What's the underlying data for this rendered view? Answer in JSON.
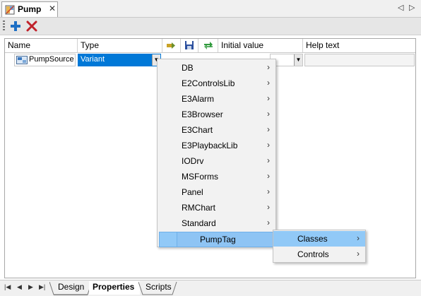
{
  "window": {
    "tab_title": "Pump",
    "close_glyph": "✕",
    "nav_prev": "◁",
    "nav_next": "▷"
  },
  "toolbar": {
    "add_icon": "plus-icon",
    "delete_icon": "delete-x-icon",
    "add_color": "#1e6fc4",
    "delete_color": "#c0212a"
  },
  "grid": {
    "columns": {
      "name": "Name",
      "type": "Type",
      "initial_value": "Initial value",
      "help_text": "Help text"
    },
    "row": {
      "name": "PumpSource",
      "type": "Variant",
      "dropdown_glyph": "▼"
    }
  },
  "type_menu": {
    "items": [
      {
        "label": "DB",
        "arrow": "›"
      },
      {
        "label": "E2ControlsLib",
        "arrow": "›"
      },
      {
        "label": "E3Alarm",
        "arrow": "›"
      },
      {
        "label": "E3Browser",
        "arrow": "›"
      },
      {
        "label": "E3Chart",
        "arrow": "›"
      },
      {
        "label": "E3PlaybackLib",
        "arrow": "›"
      },
      {
        "label": "IODrv",
        "arrow": "›"
      },
      {
        "label": "MSForms",
        "arrow": "›"
      },
      {
        "label": "Panel",
        "arrow": "›"
      },
      {
        "label": "RMChart",
        "arrow": "›"
      },
      {
        "label": "Standard",
        "arrow": "›"
      },
      {
        "label": "PumpTag",
        "arrow": ""
      }
    ],
    "highlight_color": "#91c9f7"
  },
  "submenu": {
    "items": [
      {
        "label": "Classes",
        "arrow": "›"
      },
      {
        "label": "Controls",
        "arrow": "›"
      }
    ]
  },
  "bottom_tabs": {
    "nav": [
      "|◀",
      "◀",
      "▶",
      "▶|"
    ],
    "design": "Design",
    "properties": "Properties",
    "scripts": "Scripts"
  }
}
